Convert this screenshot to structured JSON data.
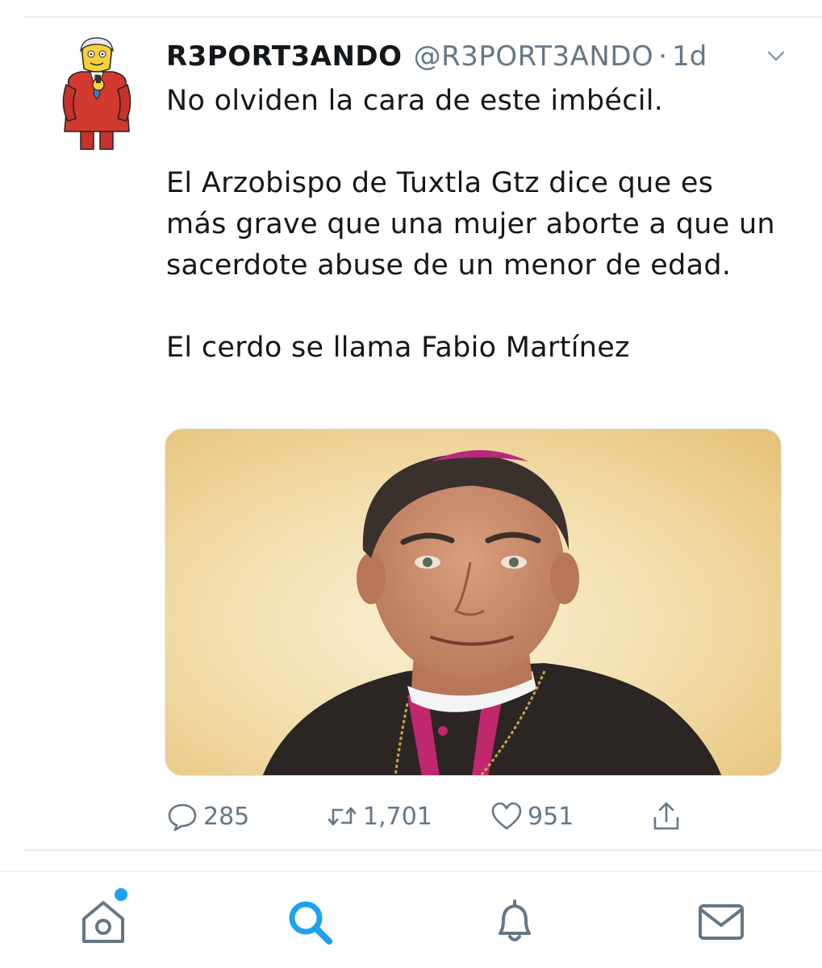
{
  "tweet": {
    "display_name": "R3PORT3ANDO",
    "handle": "@R3PORT3ANDO",
    "separator": "·",
    "time": "1d",
    "paragraphs": [
      "No olviden la cara de este imbécil.",
      "El Arzobispo de Tuxtla Gtz dice que es más grave que una mujer aborte a que un sacerdote abuse de un menor de edad.",
      "El cerdo se llama Fabio Martínez"
    ],
    "media": {
      "description": "photo"
    },
    "actions": {
      "replies": "285",
      "retweets": "1,701",
      "likes": "951"
    }
  },
  "tabbar": {
    "items": [
      {
        "icon": "home-icon",
        "active": false,
        "has_badge": true
      },
      {
        "icon": "search-icon",
        "active": true
      },
      {
        "icon": "bell-icon",
        "active": false
      },
      {
        "icon": "mail-icon",
        "active": false
      }
    ]
  },
  "colors": {
    "text": "#14171a",
    "secondary": "#657786",
    "accent": "#1da1f2",
    "border": "#e6ecf0"
  }
}
